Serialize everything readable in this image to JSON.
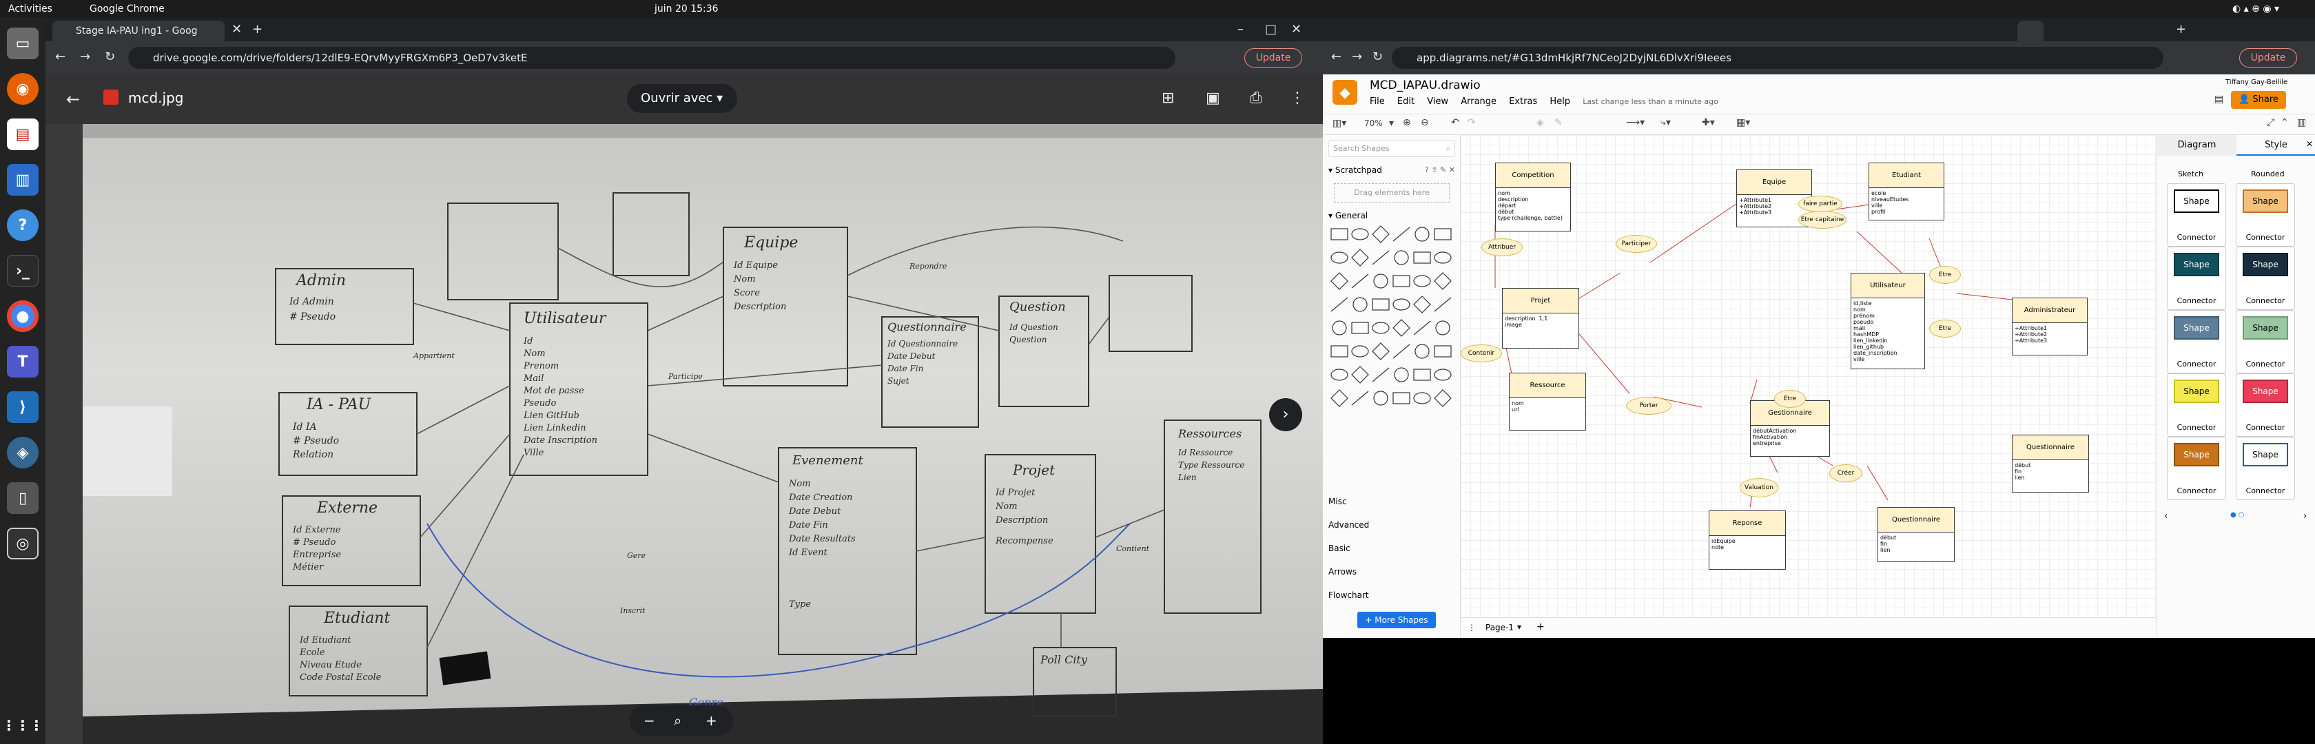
{
  "topbar": {
    "activities": "Activities",
    "app": "Google Chrome",
    "clock": "juin 20  15:36"
  },
  "left_window": {
    "tab_title": "Stage IA-PAU ing1 - Goog",
    "url": "drive.google.com/drive/folders/12dlE9-EQrvMyyFRGXm6P3_OeD7v3ketE",
    "update": "Update",
    "file_name": "mcd.jpg",
    "open_with": "Ouvrir avec",
    "whiteboard": {
      "admin": [
        "Admin",
        "Id Admin",
        "# Pseudo"
      ],
      "iapau": [
        "IA - PAU",
        "Id IA",
        "# Pseudo",
        "Relation"
      ],
      "externe": [
        "Externe",
        "Id Externe",
        "# Pseudo",
        "Entreprise",
        "Métier"
      ],
      "etudiant": [
        "Etudiant",
        "Id Etudiant",
        "Ecole",
        "Niveau Etude",
        "Code Postal Ecole"
      ],
      "utilisateur": [
        "Utilisateur",
        "Id",
        "Nom",
        "Prenom",
        "Mail",
        "Mot de passe",
        "Pseudo",
        "Lien GitHub",
        "Lien Linkedin",
        "Date Inscription",
        "Ville"
      ],
      "equipe": [
        "Equipe",
        "Id Equipe",
        "Nom",
        "Score",
        "Description"
      ],
      "questionnaire": [
        "Questionnaire",
        "Id Questionnaire",
        "Date Debut",
        "Date Fin",
        "Sujet"
      ],
      "question": [
        "Question",
        "Id Question",
        "Question"
      ],
      "evenement": [
        "Evenement",
        "Nom",
        "Date Creation",
        "Date Debut",
        "Date Fin",
        "Date Resultats",
        "Id Event",
        "Type"
      ],
      "projet": [
        "Projet",
        "Id Projet",
        "Nom",
        "Description",
        "Recompense"
      ],
      "ressources": [
        "Ressources",
        "Id Ressource",
        "Type Ressource",
        "Lien"
      ],
      "poll": [
        "Poll City"
      ],
      "other": [
        "Genre",
        "Appartient",
        "Participe",
        "Repondre",
        "Gere",
        "Inscrit",
        "Contient"
      ]
    }
  },
  "right_window": {
    "url": "app.diagrams.net/#G13dmHkjRf7NCeoJ2DyjNL6DlvXri9Ieees",
    "update": "Update",
    "doc_title": "MCD_IAPAU.drawio",
    "user": "Tiffany Gay-Bellile",
    "share": "Share",
    "menu": [
      "File",
      "Edit",
      "View",
      "Arrange",
      "Extras",
      "Help"
    ],
    "last_change": "Last change less than a minute ago",
    "zoom": "70%",
    "search_placeholder": "Search Shapes",
    "scratchpad": "Scratchpad",
    "drag_hint": "Drag elements here",
    "general": "General",
    "libraries": [
      "Misc",
      "Advanced",
      "Basic",
      "Arrows",
      "Flowchart"
    ],
    "more_shapes": "+ More Shapes",
    "page": "Page-1",
    "panel_tabs": [
      "Diagram",
      "Style"
    ],
    "style_labels": [
      "Sketch",
      "Rounded"
    ],
    "style_cards": [
      {
        "fill": "#ffffff",
        "stroke": "#000000"
      },
      {
        "fill": "#f5c07a",
        "stroke": "#c0712f"
      },
      {
        "fill": "#10505c",
        "stroke": "#0a3a42"
      },
      {
        "fill": "#182e3e",
        "stroke": "#0d1b26"
      },
      {
        "fill": "#5d7f99",
        "stroke": "#3f5a70"
      },
      {
        "fill": "#9ac7a0",
        "stroke": "#6f9e76"
      },
      {
        "fill": "#f6e94f",
        "stroke": "#c9bb20"
      },
      {
        "fill": "#e83e57",
        "stroke": "#b0283c"
      },
      {
        "fill": "#c8731a",
        "stroke": "#8f4f0f"
      },
      {
        "fill": "#ffffff",
        "stroke": "#0c6b6b"
      }
    ],
    "shape_text": "Shape",
    "connector_text": "Connector",
    "entities": [
      {
        "name": "Competition",
        "body": "nom\ndescription\ndépart\ndébut\ntype (challenge, battle)"
      },
      {
        "name": "Projet",
        "body": "description  1,1\nimage"
      },
      {
        "name": "Ressource",
        "body": "nom\nurl"
      },
      {
        "name": "Equipe",
        "body": "+Attribute1\n+Attribute2\n+Attribute3"
      },
      {
        "name": "Etudiant",
        "body": "ecole\nniveauEtudes\nville\nprofil"
      },
      {
        "name": "Utilisateur",
        "body": "id,liste\nnom\nprénom\npseudo\nmail\nhashMDP\nlien_linkedin\nlien_github\ndate_inscription\nville"
      },
      {
        "name": "Administrateur",
        "body": "+Attribute1\n+Attribute2\n+Attribute3"
      },
      {
        "name": "Gestionnaire",
        "body": "débutActivation\nfinActivation\nentreprise"
      },
      {
        "name": "Questionnaire",
        "body": "début\nfin\nlien"
      },
      {
        "name": "Reponse",
        "body": "idEquipe\nnote"
      },
      {
        "name": "Questionnaire",
        "body": "début\nfin\nlien"
      }
    ],
    "relations": [
      "Attribuer",
      "Participer",
      "Contenir",
      "Porter",
      "faire partie",
      "Etre capitaine",
      "Etre",
      "Etre",
      "Etre",
      "Créer",
      "Valuation"
    ]
  }
}
